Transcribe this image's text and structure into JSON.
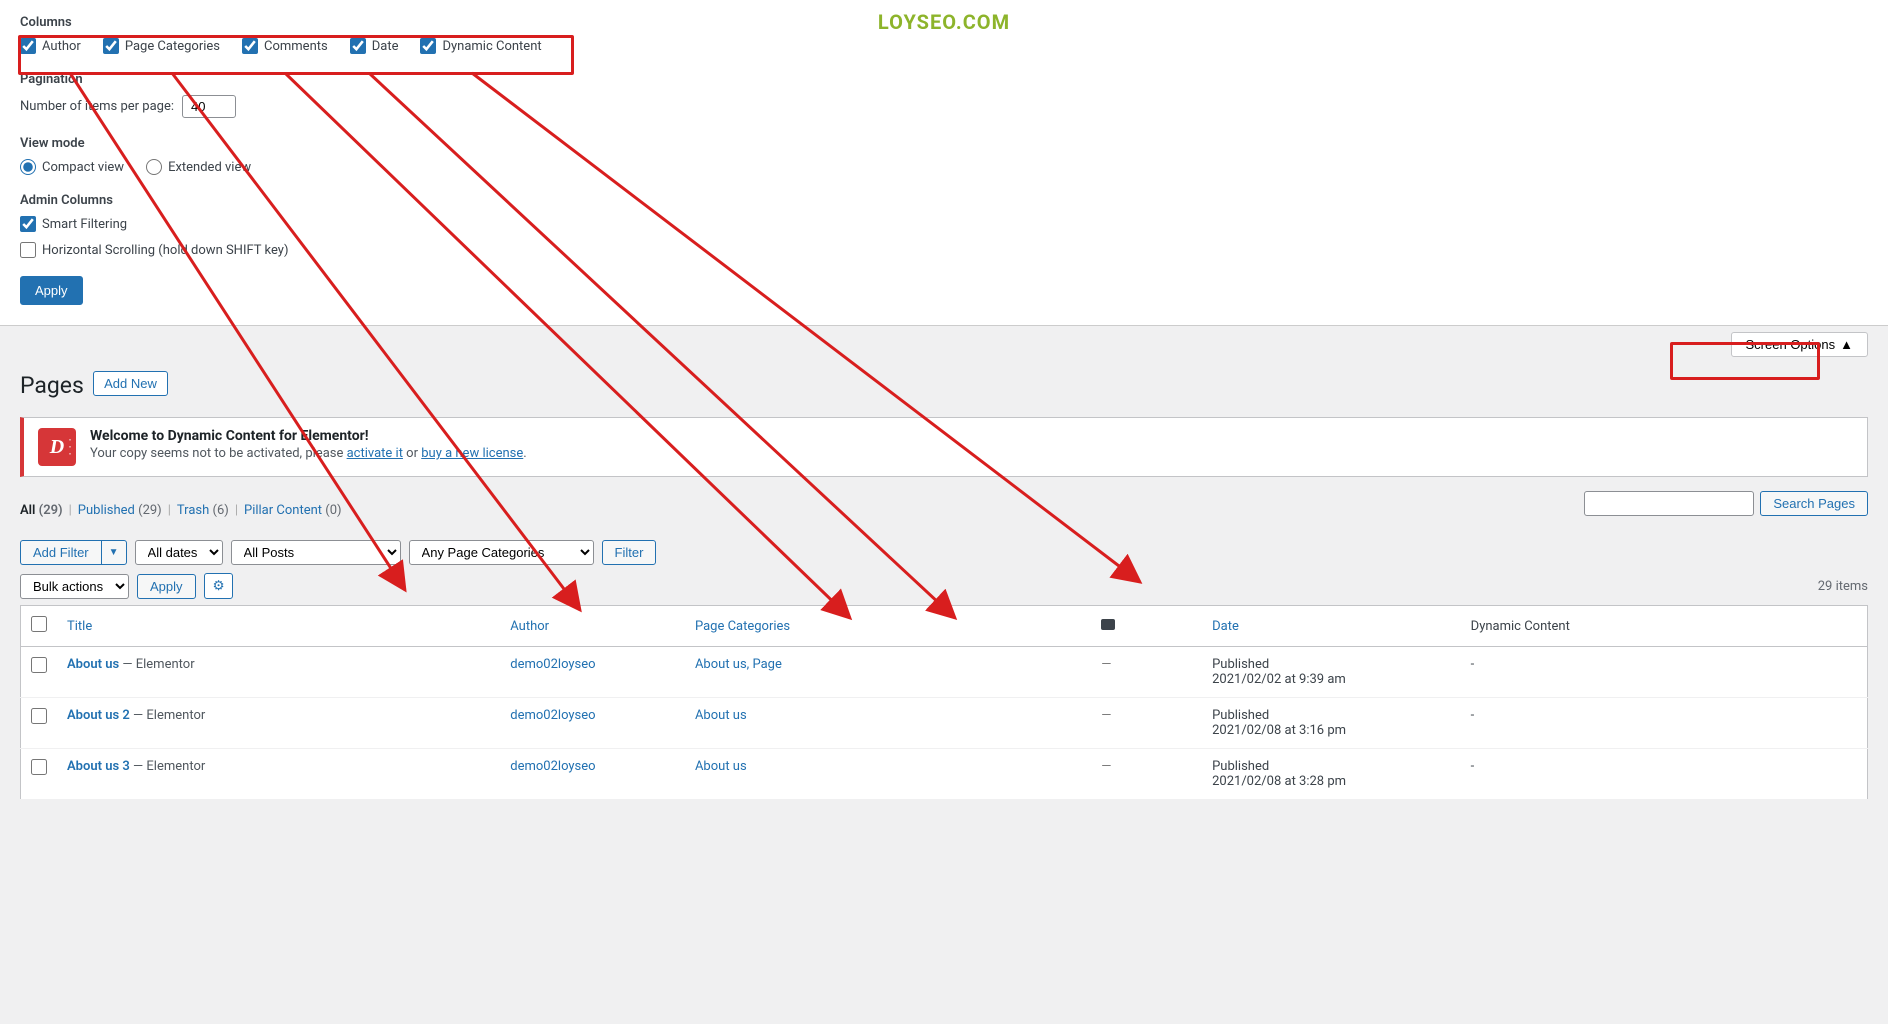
{
  "watermark": "LOYSEO.COM",
  "screen_options": {
    "columns_legend": "Columns",
    "columns": [
      {
        "label": "Author",
        "checked": true
      },
      {
        "label": "Page Categories",
        "checked": true
      },
      {
        "label": "Comments",
        "checked": true
      },
      {
        "label": "Date",
        "checked": true
      },
      {
        "label": "Dynamic Content",
        "checked": true
      }
    ],
    "pagination_legend": "Pagination",
    "per_page_label": "Number of items per page:",
    "per_page_value": "40",
    "view_mode_legend": "View mode",
    "view_compact": "Compact view",
    "view_extended": "Extended view",
    "admin_cols_legend": "Admin Columns",
    "smart_filtering": "Smart Filtering",
    "horiz_scroll": "Horizontal Scrolling (hold down SHIFT key)",
    "apply": "Apply",
    "toggle_label": "Screen Options"
  },
  "page": {
    "title": "Pages",
    "add_new": "Add New"
  },
  "notice": {
    "icon_text": "D",
    "title": "Welcome to Dynamic Content for Elementor!",
    "lead": "Your copy seems not to be activated, please ",
    "link1": "activate it",
    "mid": " or ",
    "link2": "buy a new license",
    "tail": "."
  },
  "filters": {
    "links": [
      {
        "label": "All",
        "count": "(29)",
        "current": true
      },
      {
        "label": "Published",
        "count": "(29)",
        "current": false
      },
      {
        "label": "Trash",
        "count": "(6)",
        "current": false
      },
      {
        "label": "Pillar Content",
        "count": "(0)",
        "current": false
      }
    ],
    "search_btn": "Search Pages",
    "add_filter": "Add Filter",
    "all_dates": "All dates",
    "all_posts": "All Posts",
    "any_cats": "Any Page Categories",
    "filter_btn": "Filter",
    "bulk_actions": "Bulk actions",
    "apply": "Apply",
    "displaying": "29 items"
  },
  "table": {
    "headers": {
      "title": "Title",
      "author": "Author",
      "categories": "Page Categories",
      "date": "Date",
      "dynamic": "Dynamic Content"
    },
    "rows": [
      {
        "title": "About us",
        "suffix": " — Elementor",
        "author": "demo02loyseo",
        "cats": "About us, Page",
        "comments": "—",
        "date_status": "Published",
        "date_value": "2021/02/02 at 9:39 am",
        "dynamic": "-"
      },
      {
        "title": "About us 2",
        "suffix": " — Elementor",
        "author": "demo02loyseo",
        "cats": "About us",
        "comments": "—",
        "date_status": "Published",
        "date_value": "2021/02/08 at 3:16 pm",
        "dynamic": "-"
      },
      {
        "title": "About us 3",
        "suffix": " — Elementor",
        "author": "demo02loyseo",
        "cats": "About us",
        "comments": "—",
        "date_status": "Published",
        "date_value": "2021/02/08 at 3:28 pm",
        "dynamic": "-"
      }
    ]
  }
}
